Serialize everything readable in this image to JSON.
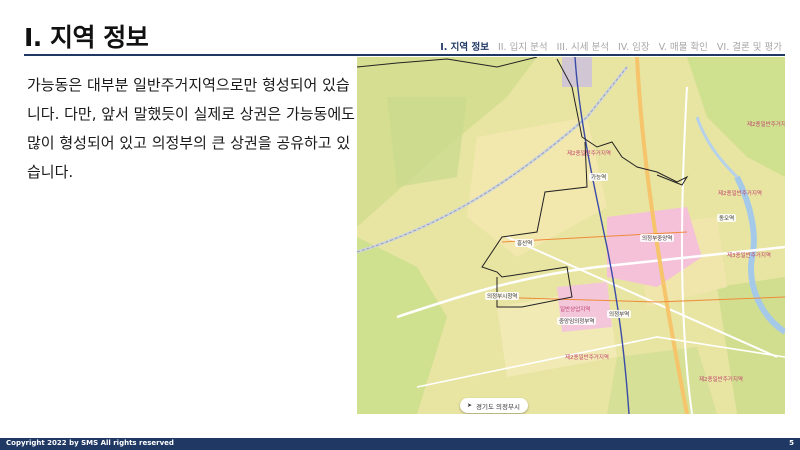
{
  "slide": {
    "title": "I. 지역 정보",
    "body": "가능동은 대부분 일반주거지역으로만 형성되어 있습니다. 다만, 앞서 말했듯이 실제로 상권은 가능동에도 많이 형성되어 있고 의정부의 큰 상권을 공유하고 있습니다."
  },
  "nav": {
    "items": [
      {
        "label": "I. 지역 정보",
        "active": true
      },
      {
        "label": "II. 입지 분석",
        "active": false
      },
      {
        "label": "III. 시세 분석",
        "active": false
      },
      {
        "label": "IV. 임장",
        "active": false
      },
      {
        "label": "V. 매물 확인",
        "active": false
      },
      {
        "label": "VI. 결론 및 평가",
        "active": false
      }
    ]
  },
  "map": {
    "location": "경기도 의정부시",
    "zones": [
      "제2종일반주거지역",
      "제2종일반주거지역",
      "제2종일반주거지역",
      "제2종일반주거지역",
      "제2종일반주거지역",
      "제3종일반주거지역",
      "일반상업지역"
    ],
    "stations": [
      "가능역",
      "흥선역",
      "의정부시청역",
      "의정부중앙역",
      "동오역",
      "의정부역",
      "중앙임의정부역"
    ]
  },
  "footer": {
    "copyright": "Copyright 2022 by SMS All rights reserved",
    "page": "5"
  }
}
